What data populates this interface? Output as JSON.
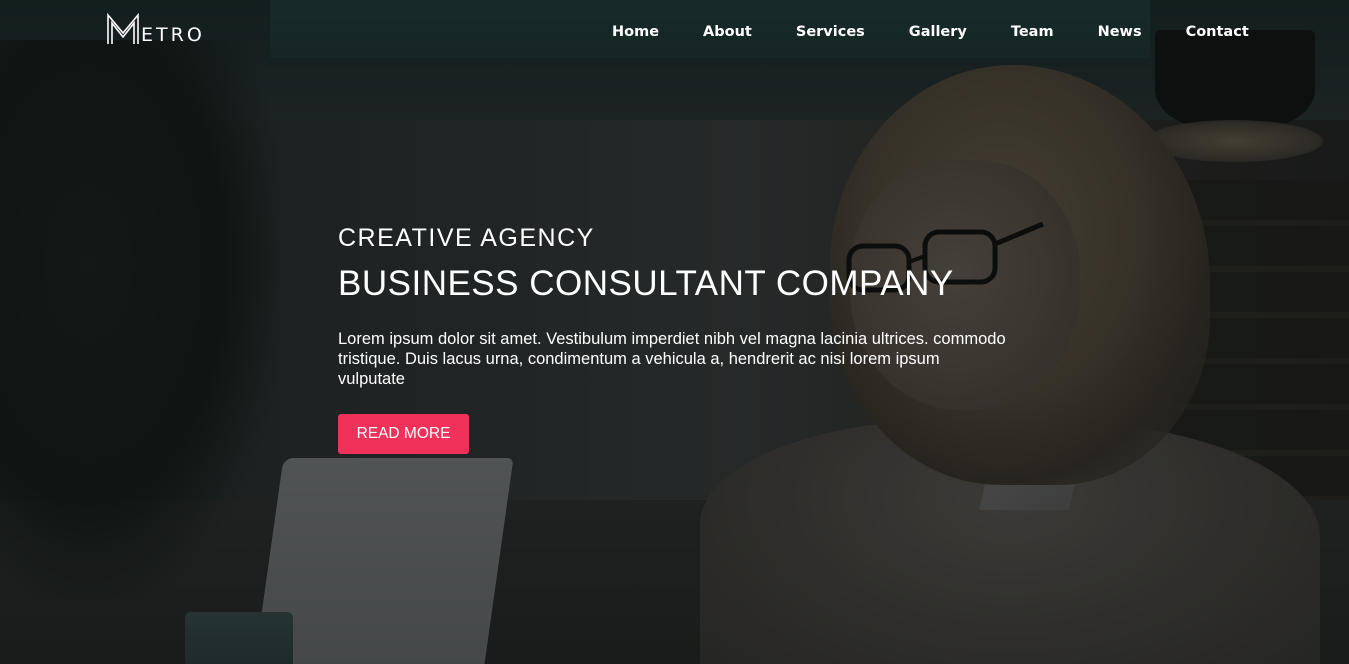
{
  "brand": {
    "logo_initial": "M",
    "logo_rest": "ETRO"
  },
  "nav": {
    "items": [
      {
        "label": "Home"
      },
      {
        "label": "About"
      },
      {
        "label": "Services"
      },
      {
        "label": "Gallery"
      },
      {
        "label": "Team"
      },
      {
        "label": "News"
      },
      {
        "label": "Contact"
      }
    ]
  },
  "hero": {
    "tagline": "CREATIVE AGENCY",
    "headline": "BUSINESS CONSULTANT COMPANY",
    "description": "Lorem ipsum dolor sit amet. Vestibulum imperdiet nibh vel magna lacinia ultrices. commodo tristique. Duis lacus urna, condimentum a vehicula a, hendrerit ac nisi lorem ipsum vulputate",
    "cta_label": "READ MORE"
  },
  "colors": {
    "accent": "#f0325a",
    "text": "#ffffff",
    "overlay": "#0a0c0c"
  },
  "icons": {
    "logo": "metro-outline-m-logo"
  }
}
